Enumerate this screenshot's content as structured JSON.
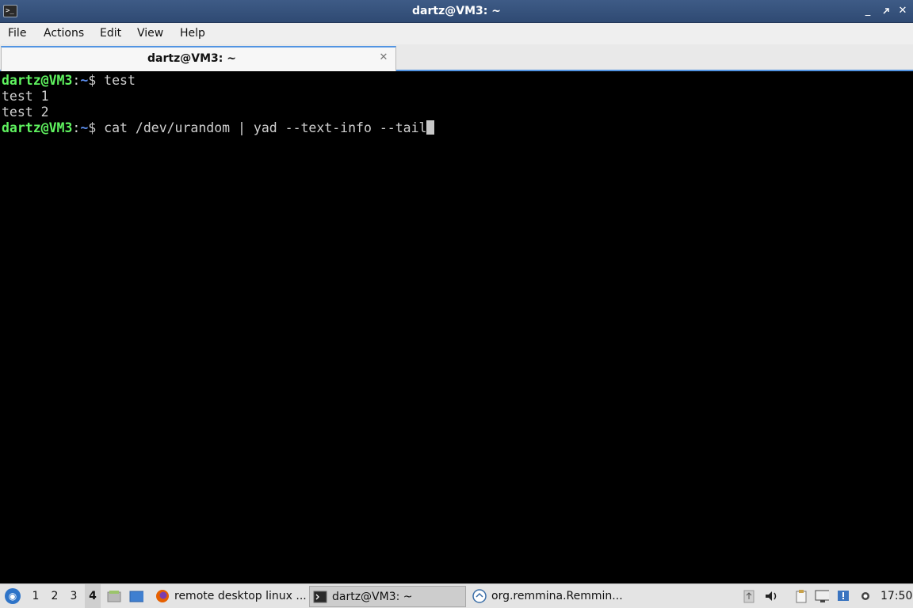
{
  "window": {
    "title": "dartz@VM3: ~",
    "app_icon": "terminal-icon",
    "buttons": {
      "minimize": "_",
      "maximize": "▫",
      "close": "✕"
    }
  },
  "menu": [
    "File",
    "Actions",
    "Edit",
    "View",
    "Help"
  ],
  "tab": {
    "label": "dartz@VM3: ~",
    "close": "✕"
  },
  "terminal": {
    "prompt_user": "dartz@VM3",
    "prompt_colon": ":",
    "prompt_path": "~",
    "prompt_dollar": "$ ",
    "lines": [
      {
        "type": "prompt",
        "command": "test"
      },
      {
        "type": "output",
        "text": "test 1"
      },
      {
        "type": "output",
        "text": "test 2"
      },
      {
        "type": "prompt",
        "command": "cat /dev/urandom | yad --text-info --tail"
      }
    ]
  },
  "taskbar": {
    "start_icon": "start-menu-icon",
    "workspaces": [
      "1",
      "2",
      "3",
      "4"
    ],
    "active_workspace": "4",
    "tasks": [
      {
        "label": "remote desktop linux ...",
        "icon": "firefox-icon"
      },
      {
        "label": "dartz@VM3: ~",
        "icon": "terminal-icon"
      },
      {
        "label": "org.remmina.Remmin...",
        "icon": "remmina-icon"
      }
    ],
    "clock": "17:50"
  },
  "colors": {
    "titlebar": "#35527c",
    "accent": "#5294e2",
    "prompt_user": "#5ff35f",
    "prompt_path": "#5c8ff0",
    "terminal_bg": "#000000",
    "terminal_fg": "#d0d0d0"
  }
}
